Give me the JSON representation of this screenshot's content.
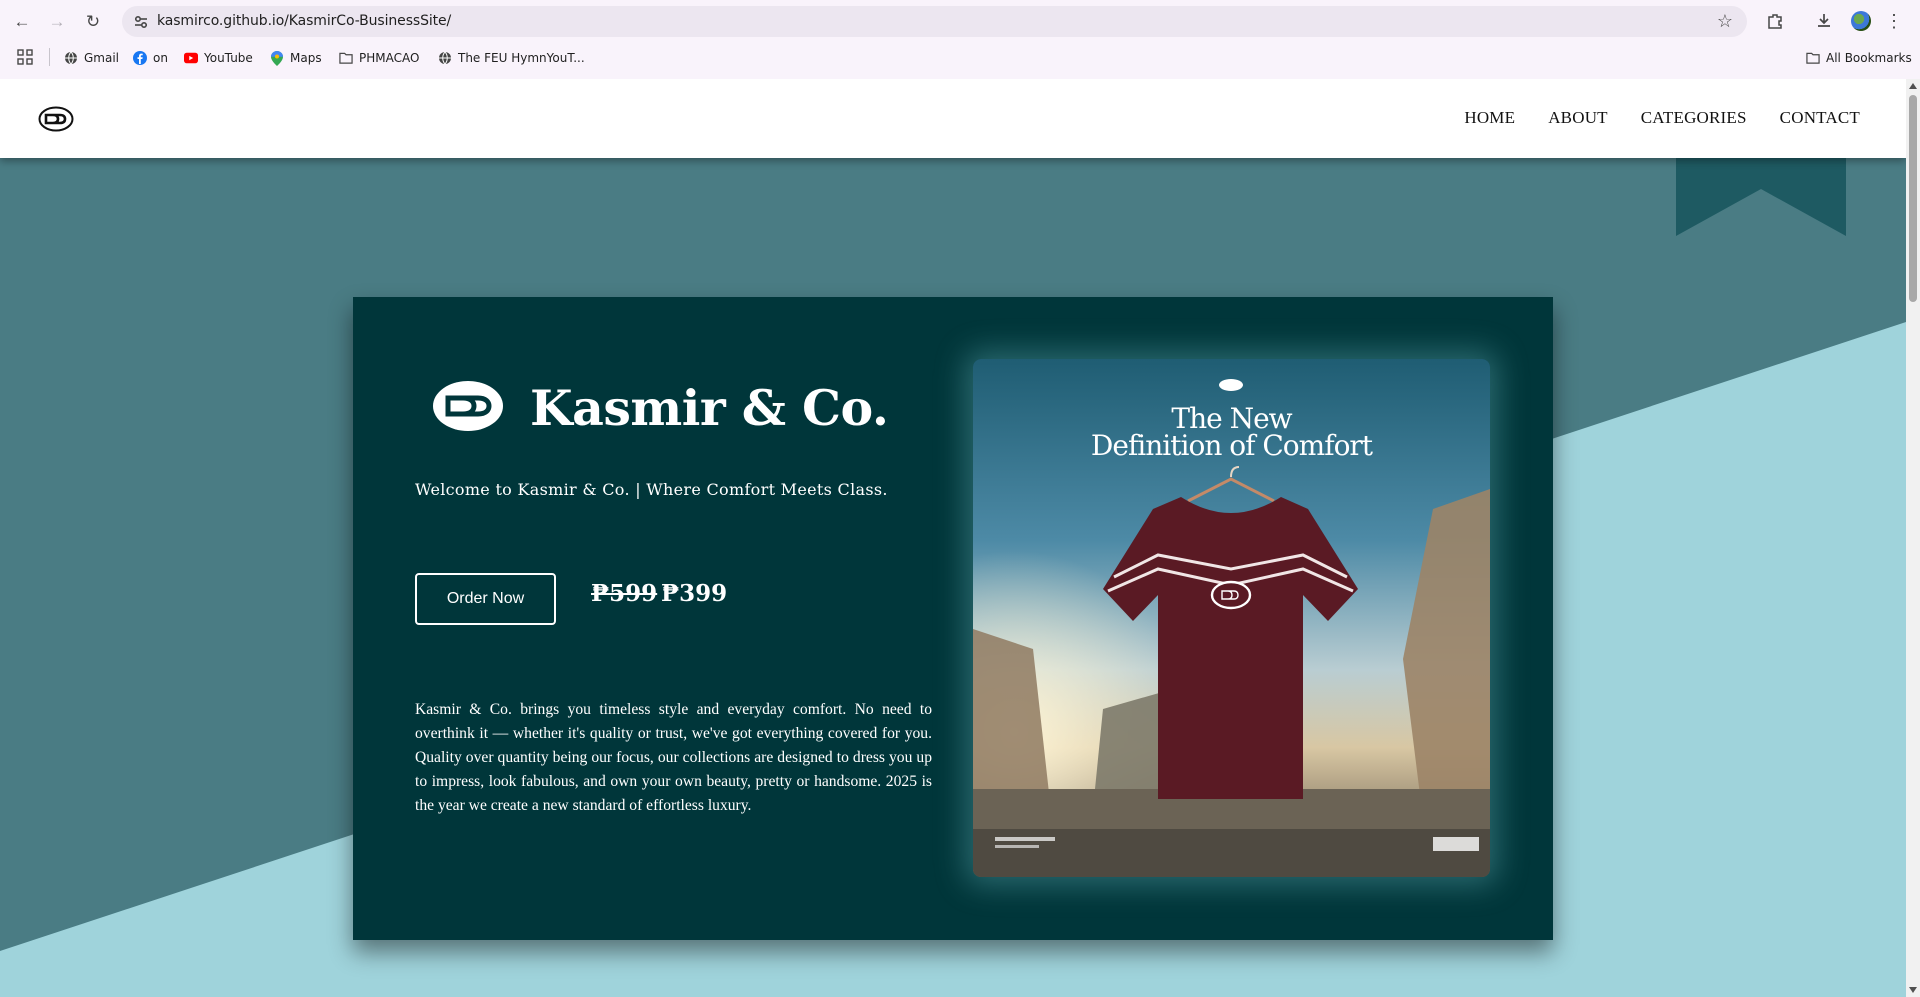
{
  "browser": {
    "url": "kasmirco.github.io/KasmirCo-BusinessSite/",
    "bookmarks": [
      {
        "label": "Gmail",
        "icon": "globe-icon"
      },
      {
        "label": "on",
        "icon": "facebook-icon"
      },
      {
        "label": "YouTube",
        "icon": "youtube-icon"
      },
      {
        "label": "Maps",
        "icon": "maps-pin-icon"
      },
      {
        "label": "PHMACAO",
        "icon": "folder-icon"
      },
      {
        "label": "The FEU HymnYouT...",
        "icon": "globe-icon"
      }
    ],
    "all_bookmarks": "All Bookmarks"
  },
  "nav": {
    "items": [
      "HOME",
      "ABOUT",
      "CATEGORIES",
      "CONTACT"
    ]
  },
  "hero": {
    "title": "Kasmir & Co.",
    "tagline": "Welcome to Kasmir & Co. | Where Comfort Meets Class.",
    "order_label": "Order Now",
    "price_old": "₱599",
    "price_new": "₱399",
    "description": "Kasmir & Co. brings you timeless style and everyday comfort. No need to overthink it — whether it's quality or trust, we've got everything covered for you. Quality over quantity being our focus, our collections are designed to dress you up to impress, look fabulous, and own your own beauty, pretty or handsome. 2025 is the year we create a new standard of effortless luxury.",
    "poster": {
      "line1": "The New",
      "line2": "Definition of Comfort"
    }
  },
  "colors": {
    "page_bg_dark": "#4a7c84",
    "page_bg_light": "#9fd3db",
    "card_bg": "#00363a",
    "ribbon": "#1e5a62",
    "shirt": "#5a1a24"
  }
}
